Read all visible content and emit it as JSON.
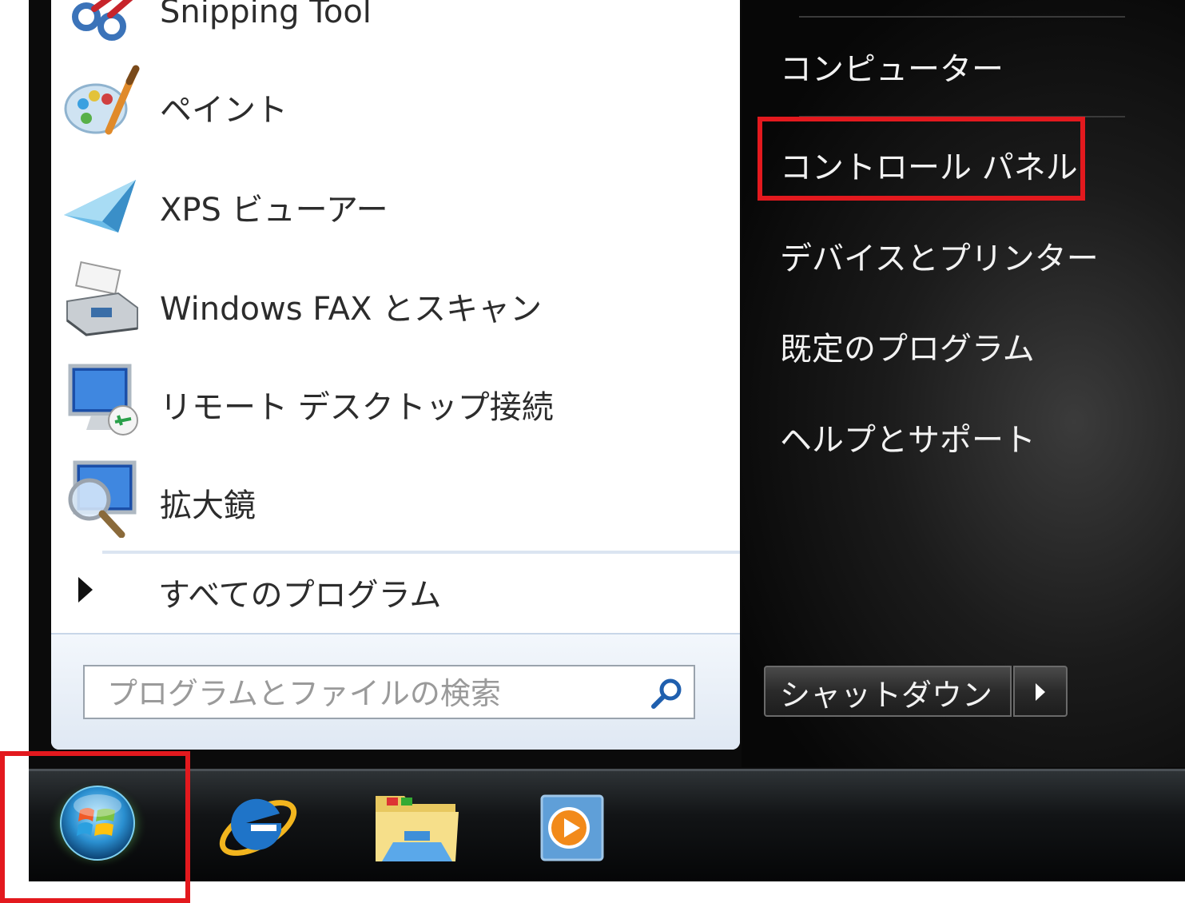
{
  "start_menu": {
    "programs": [
      {
        "label": "Snipping Tool",
        "icon": "scissors-icon"
      },
      {
        "label": "ペイント",
        "icon": "paint-palette-icon"
      },
      {
        "label": "XPS ビューアー",
        "icon": "paper-plane-icon"
      },
      {
        "label": "Windows FAX とスキャン",
        "icon": "fax-scanner-icon"
      },
      {
        "label": "リモート デスクトップ接続",
        "icon": "remote-desktop-icon"
      },
      {
        "label": "拡大鏡",
        "icon": "magnifier-icon"
      }
    ],
    "all_programs_label": "すべてのプログラム",
    "search": {
      "placeholder": "プログラムとファイルの検索"
    },
    "right_items": [
      {
        "label": "コンピューター"
      },
      {
        "label": "コントロール パネル",
        "highlighted": true
      },
      {
        "label": "デバイスとプリンター"
      },
      {
        "label": "既定のプログラム"
      },
      {
        "label": "ヘルプとサポート"
      }
    ],
    "shutdown_label": "シャットダウン"
  },
  "taskbar": {
    "items": [
      {
        "name": "start-orb",
        "highlighted": true
      },
      {
        "name": "internet-explorer"
      },
      {
        "name": "windows-explorer"
      },
      {
        "name": "windows-media-player"
      }
    ]
  },
  "colors": {
    "highlight": "#e3191e",
    "panel_dark": "#0b0b0b",
    "menu_white": "#ffffff"
  }
}
